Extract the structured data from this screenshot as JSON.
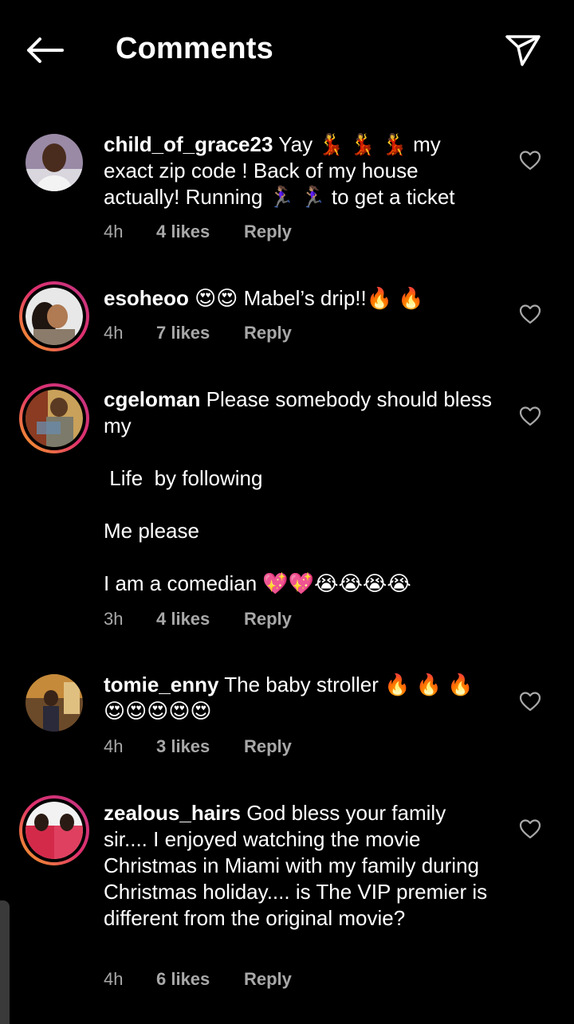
{
  "header": {
    "title": "Comments"
  },
  "comments": [
    {
      "username": "child_of_grace23",
      "text": " Yay 💃 💃 💃 my exact zip code ! Back of my house actually! Running 🏃🏽‍♀️ 🏃🏽‍♀️ to get a ticket",
      "time": "4h",
      "likes": "4 likes",
      "reply": "Reply"
    },
    {
      "username": "esoheoo",
      "text": " 😍😍 Mabel’s drip!!🔥 🔥",
      "time": "4h",
      "likes": "7 likes",
      "reply": "Reply"
    },
    {
      "username": "cgeloman",
      "text": " Please somebody should bless my\n\n Life  by following\n\nMe please\n\nI am a comedian 💖💖😭😭😭😭",
      "time": "3h",
      "likes": "4 likes",
      "reply": "Reply"
    },
    {
      "username": "tomie_enny",
      "text": " The baby stroller 🔥 🔥 🔥\n😍😍😍😍😍",
      "time": "4h",
      "likes": "3 likes",
      "reply": "Reply"
    },
    {
      "username": "zealous_hairs",
      "text": " God bless your family sir.... I enjoyed watching the movie Christmas in Miami with my family during Christmas holiday.... is The VIP premier is different from the original movie?",
      "time": "4h",
      "likes": "6 likes",
      "reply": "Reply"
    }
  ]
}
